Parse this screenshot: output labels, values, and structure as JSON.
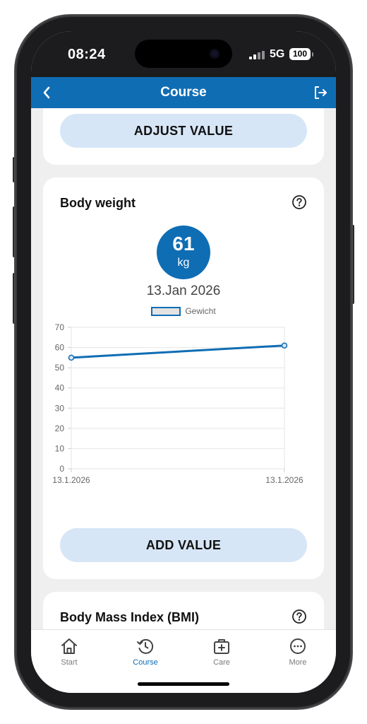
{
  "status_bar": {
    "time": "08:24",
    "network": "5G",
    "battery": "100"
  },
  "header": {
    "title": "Course",
    "back_icon": "chevron-left-icon",
    "logout_icon": "logout-icon"
  },
  "cards": {
    "previous": {
      "button_label": "ADJUST VALUE"
    },
    "body_weight": {
      "title": "Body weight",
      "help_icon": "help-circle-icon",
      "current_value": "61",
      "unit": "kg",
      "date": "13.Jan 2026",
      "button_label": "ADD VALUE"
    },
    "bmi": {
      "title": "Body Mass Index (BMI)",
      "help_icon": "help-circle-icon"
    }
  },
  "chart_data": {
    "type": "line",
    "x": [
      "13.1.2026",
      "13.1.2026"
    ],
    "series": [
      {
        "name": "Gewicht",
        "values": [
          55,
          61
        ]
      }
    ],
    "ylim": [
      0,
      70
    ],
    "yticks": [
      "0",
      "10",
      "20",
      "30",
      "40",
      "50",
      "60",
      "70"
    ],
    "xticks": [
      "13.1.2026",
      "13.1.2026"
    ],
    "grid": true,
    "legend": "top-center",
    "colors": {
      "line": "#0f6db4",
      "grid": "#e6e6e6",
      "legend_fill": "#e3e3e3"
    }
  },
  "tab_bar": {
    "tabs": [
      {
        "label": "Start",
        "icon": "home-icon",
        "active": false
      },
      {
        "label": "Course",
        "icon": "history-icon",
        "active": true
      },
      {
        "label": "Care",
        "icon": "medical-bag-icon",
        "active": false
      },
      {
        "label": "More",
        "icon": "more-dots-icon",
        "active": false
      }
    ]
  },
  "colors": {
    "brand": "#0f6db4",
    "button_bg": "#d7e6f6",
    "background": "#efefef"
  }
}
